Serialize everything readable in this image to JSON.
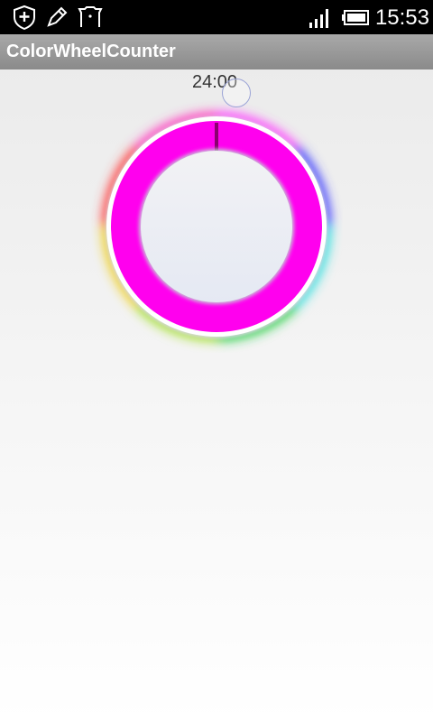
{
  "status_bar": {
    "time": "15:53",
    "icons": [
      "shield-plus-icon",
      "pen-icon",
      "notification-app-icon",
      "signal-icon",
      "battery-icon"
    ]
  },
  "action_bar": {
    "title": "ColorWheelCounter"
  },
  "counter": {
    "time_text": "24:00",
    "progress_fraction": 1.0
  },
  "colors": {
    "ring_color": "#ff00ee",
    "ring_divider": "#8a006e",
    "status_bar": "#000000",
    "action_bar": "#999999"
  }
}
